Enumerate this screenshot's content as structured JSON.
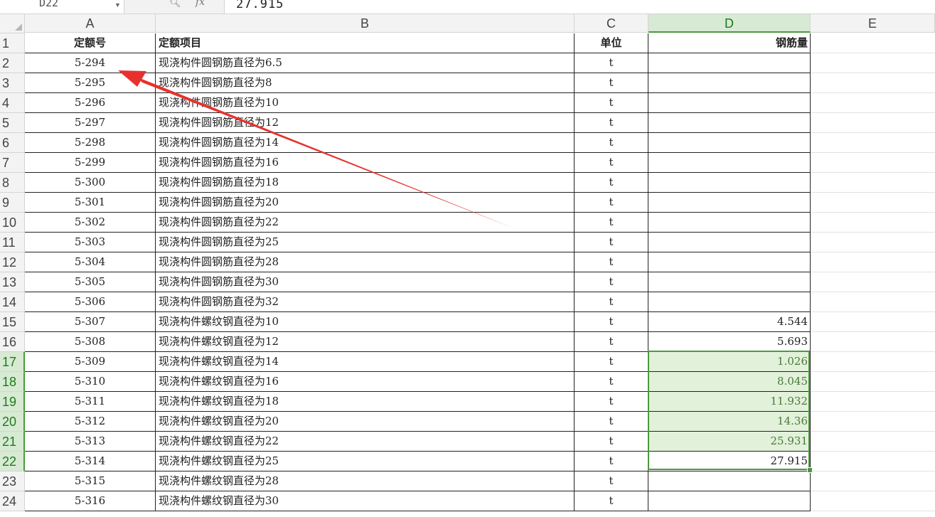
{
  "formula_bar": {
    "name_box": "D22",
    "zoom_icon": "magnifier-icon",
    "fx_label": "fx",
    "value": "27.915"
  },
  "columns": [
    "A",
    "B",
    "C",
    "D",
    "E"
  ],
  "selected_column": "D",
  "selected_rows": [
    17,
    18,
    19,
    20,
    21,
    22
  ],
  "header_row": {
    "row_number": "1",
    "a": "定额号",
    "b": "定额项目",
    "c": "单位",
    "d": "钢筋量"
  },
  "rows": [
    {
      "n": "2",
      "a": "5-294",
      "b": "现浇构件圆钢筋直径为6.5",
      "c": "t",
      "d": ""
    },
    {
      "n": "3",
      "a": "5-295",
      "b": "现浇构件圆钢筋直径为8",
      "c": "t",
      "d": ""
    },
    {
      "n": "4",
      "a": "5-296",
      "b": "现浇构件圆钢筋直径为10",
      "c": "t",
      "d": ""
    },
    {
      "n": "5",
      "a": "5-297",
      "b": "现浇构件圆钢筋直径为12",
      "c": "t",
      "d": ""
    },
    {
      "n": "6",
      "a": "5-298",
      "b": "现浇构件圆钢筋直径为14",
      "c": "t",
      "d": ""
    },
    {
      "n": "7",
      "a": "5-299",
      "b": "现浇构件圆钢筋直径为16",
      "c": "t",
      "d": ""
    },
    {
      "n": "8",
      "a": "5-300",
      "b": "现浇构件圆钢筋直径为18",
      "c": "t",
      "d": ""
    },
    {
      "n": "9",
      "a": "5-301",
      "b": "现浇构件圆钢筋直径为20",
      "c": "t",
      "d": ""
    },
    {
      "n": "10",
      "a": "5-302",
      "b": "现浇构件圆钢筋直径为22",
      "c": "t",
      "d": ""
    },
    {
      "n": "11",
      "a": "5-303",
      "b": "现浇构件圆钢筋直径为25",
      "c": "t",
      "d": ""
    },
    {
      "n": "12",
      "a": "5-304",
      "b": "现浇构件圆钢筋直径为28",
      "c": "t",
      "d": ""
    },
    {
      "n": "13",
      "a": "5-305",
      "b": "现浇构件圆钢筋直径为30",
      "c": "t",
      "d": ""
    },
    {
      "n": "14",
      "a": "5-306",
      "b": "现浇构件圆钢筋直径为32",
      "c": "t",
      "d": ""
    },
    {
      "n": "15",
      "a": "5-307",
      "b": "现浇构件螺纹钢直径为10",
      "c": "t",
      "d": "4.544"
    },
    {
      "n": "16",
      "a": "5-308",
      "b": "现浇构件螺纹钢直径为12",
      "c": "t",
      "d": "5.693"
    },
    {
      "n": "17",
      "a": "5-309",
      "b": "现浇构件螺纹钢直径为14",
      "c": "t",
      "d": "1.026"
    },
    {
      "n": "18",
      "a": "5-310",
      "b": "现浇构件螺纹钢直径为16",
      "c": "t",
      "d": "8.045"
    },
    {
      "n": "19",
      "a": "5-311",
      "b": "现浇构件螺纹钢直径为18",
      "c": "t",
      "d": "11.932"
    },
    {
      "n": "20",
      "a": "5-312",
      "b": "现浇构件螺纹钢直径为20",
      "c": "t",
      "d": "14.36"
    },
    {
      "n": "21",
      "a": "5-313",
      "b": "现浇构件螺纹钢直径为22",
      "c": "t",
      "d": "25.931"
    },
    {
      "n": "22",
      "a": "5-314",
      "b": "现浇构件螺纹钢直径为25",
      "c": "t",
      "d": "27.915"
    },
    {
      "n": "23",
      "a": "5-315",
      "b": "现浇构件螺纹钢直径为28",
      "c": "t",
      "d": ""
    },
    {
      "n": "24",
      "a": "5-316",
      "b": "现浇构件螺纹钢直径为30",
      "c": "t",
      "d": ""
    }
  ],
  "annotation": {
    "type": "red-arrow-icon",
    "color": "#e8312d"
  },
  "colors": {
    "selection": "#4a9a3d",
    "selection_fill": "#e2f1da",
    "grid_line": "#222222"
  }
}
